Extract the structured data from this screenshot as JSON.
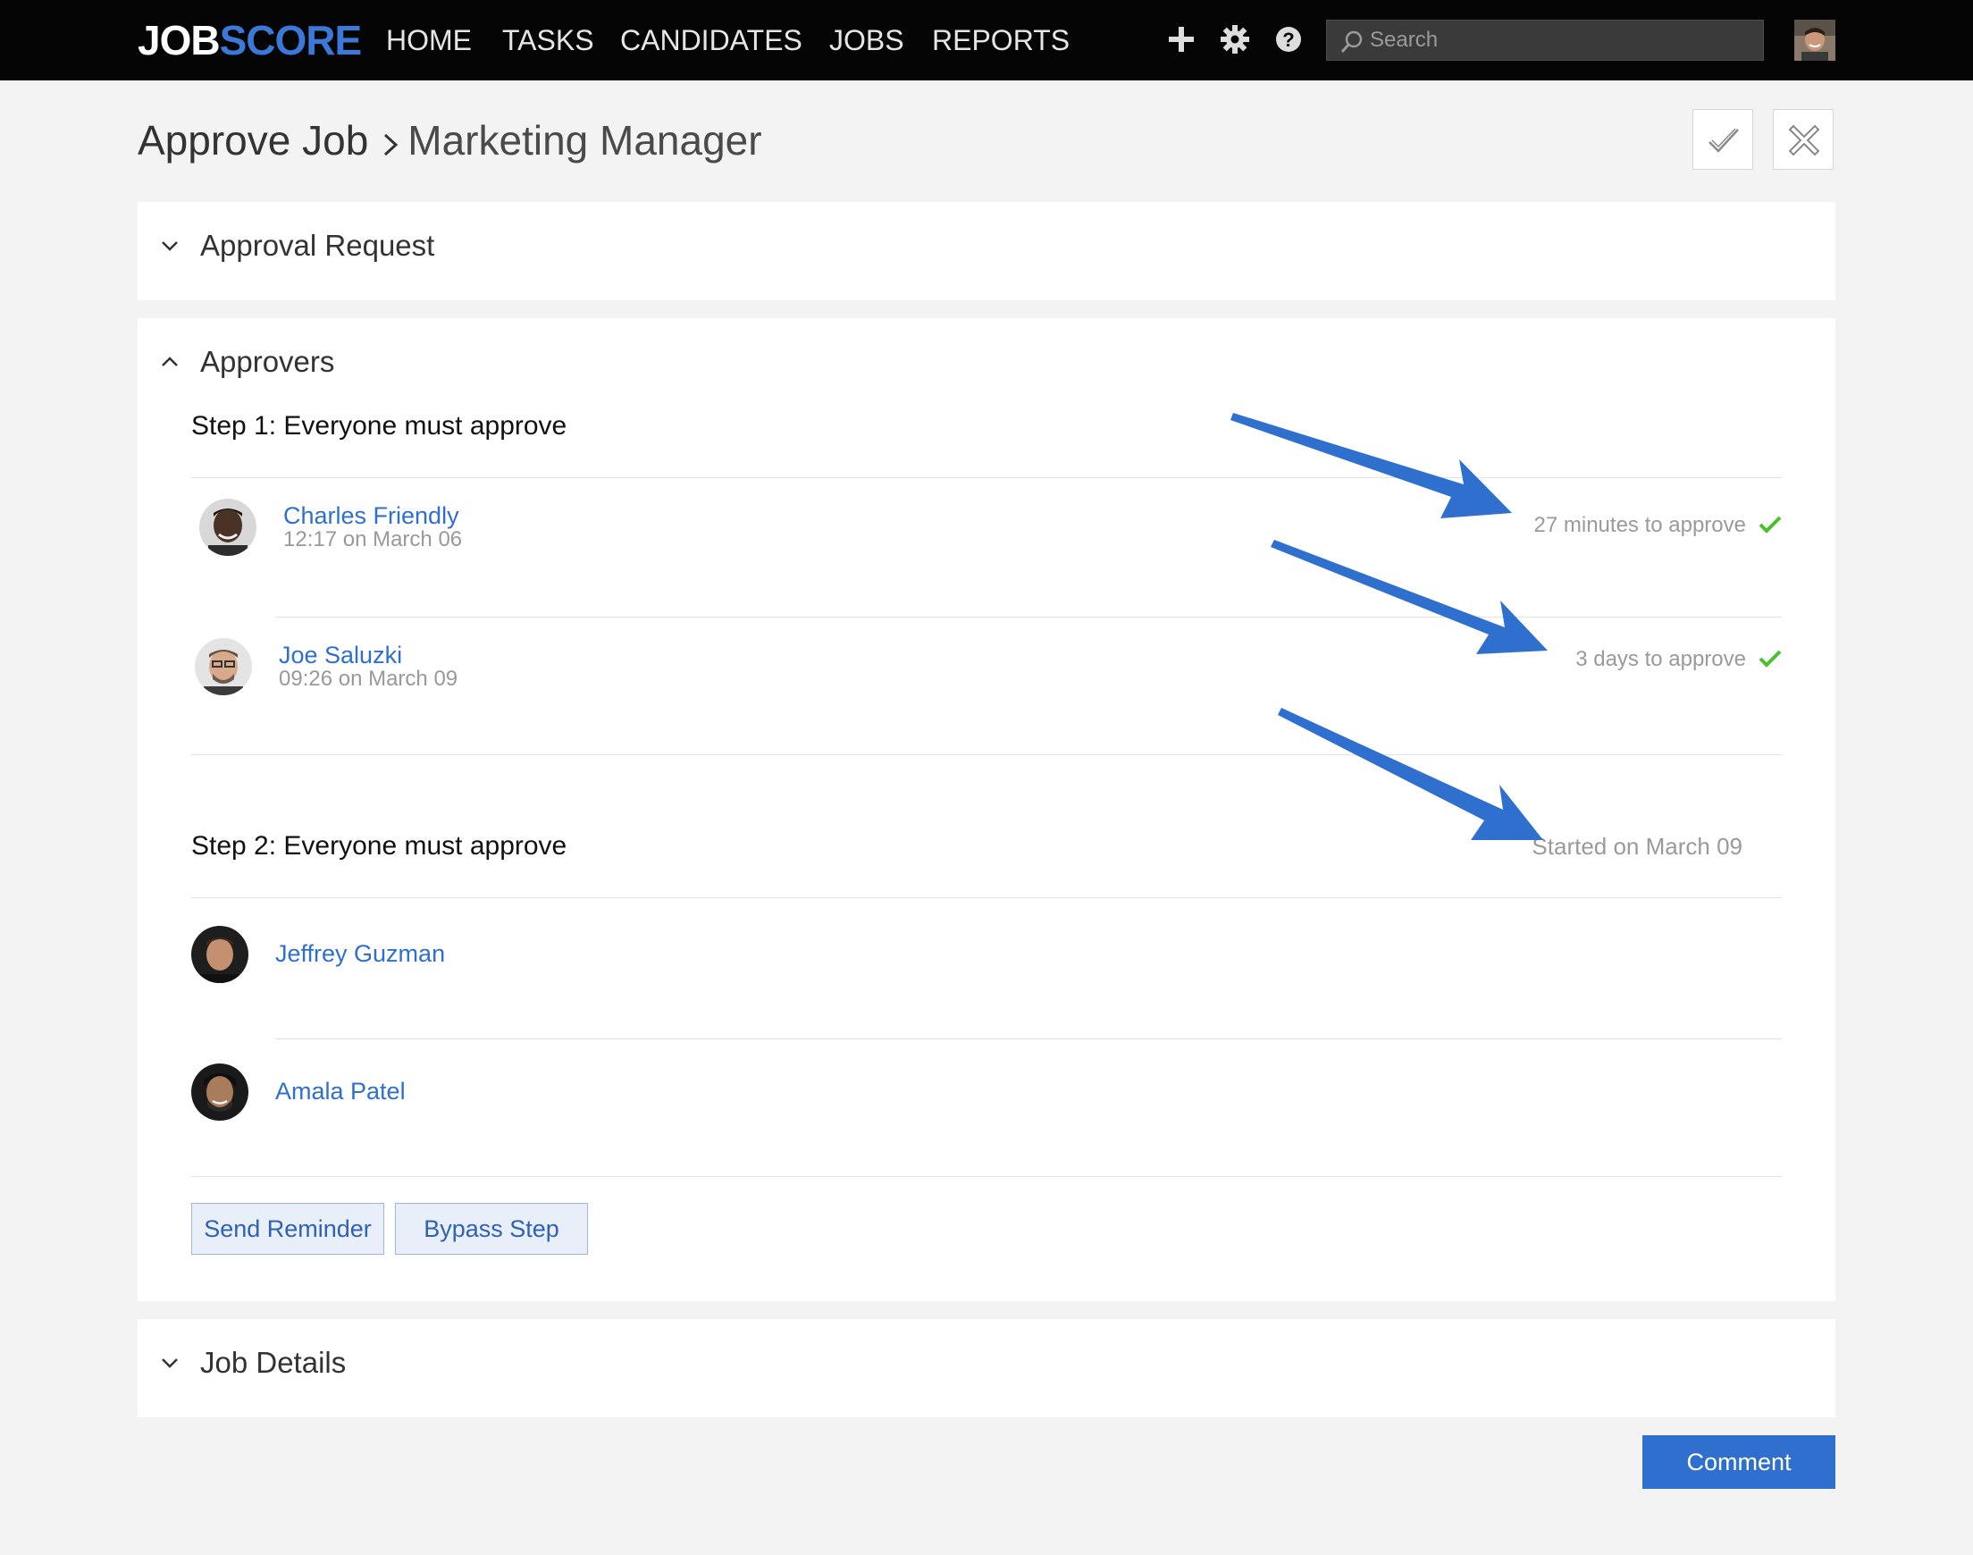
{
  "navbar": {
    "logo_job": "JOB",
    "logo_score": "SCORE",
    "items": [
      "HOME",
      "TASKS",
      "CANDIDATES",
      "JOBS",
      "REPORTS"
    ],
    "icons": [
      "plus-icon",
      "gear-icon",
      "help-icon"
    ],
    "search_placeholder": "Search"
  },
  "header": {
    "title": "Approve Job",
    "job_name": "Marketing Manager",
    "icons": [
      "approve-check-icon",
      "reject-x-icon"
    ]
  },
  "approval_request": {
    "label": "Approval Request"
  },
  "approvers": {
    "label": "Approvers",
    "steps": [
      {
        "title": "Step 1: Everyone must approve",
        "status": "",
        "people": [
          {
            "name": "Charles Friendly",
            "time": "12:17 on March 06",
            "status": "27 minutes to approve"
          },
          {
            "name": "Joe Saluzki",
            "time": "09:26 on March 09",
            "status": "3 days to approve"
          }
        ]
      },
      {
        "title": "Step 2: Everyone must approve",
        "status": "Started on March 09",
        "people": [
          {
            "name": "Jeffrey Guzman"
          },
          {
            "name": "Amala Patel"
          }
        ]
      }
    ],
    "send_reminder": "Send Reminder",
    "bypass_step": "Bypass Step"
  },
  "job_details": {
    "label": "Job Details"
  },
  "comment_button": "Comment",
  "colors": {
    "navbar_bg": "#050505",
    "brand_blue": "#3c78d8",
    "link_blue": "#2f6fce",
    "annotation_arrow": "#2f6fce",
    "check_green": "#4cbf2f"
  }
}
